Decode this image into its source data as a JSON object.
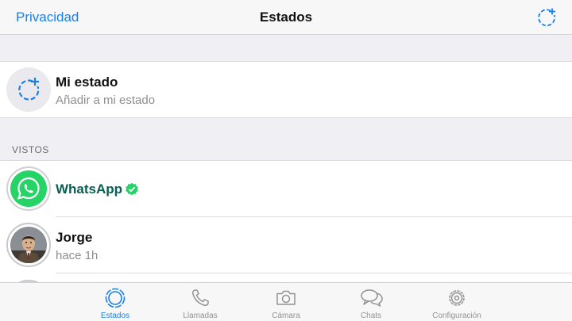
{
  "navbar": {
    "left_label": "Privacidad",
    "title": "Estados",
    "right_icon": "status-add-icon"
  },
  "my_status": {
    "title": "Mi estado",
    "subtitle": "Añadir a mi estado",
    "icon": "status-add-icon"
  },
  "viewed_header": "VISTOS",
  "contacts": [
    {
      "name": "WhatsApp",
      "subtitle": "",
      "verified": true,
      "avatar": "whatsapp-logo",
      "name_color": "#075e54"
    },
    {
      "name": "Jorge",
      "subtitle": "hace 1h",
      "verified": false,
      "avatar": "photo"
    }
  ],
  "tabs": [
    {
      "label": "Estados",
      "icon": "status-icon",
      "active": true
    },
    {
      "label": "Llamadas",
      "icon": "phone-icon",
      "active": false
    },
    {
      "label": "Cámara",
      "icon": "camera-icon",
      "active": false
    },
    {
      "label": "Chats",
      "icon": "chat-bubbles-icon",
      "active": false
    },
    {
      "label": "Configuración",
      "icon": "gear-icon",
      "active": false
    }
  ],
  "colors": {
    "accent": "#1a80e6",
    "whatsapp_green": "#25d366",
    "whatsapp_dark": "#075e54",
    "verified": "#25d366"
  }
}
